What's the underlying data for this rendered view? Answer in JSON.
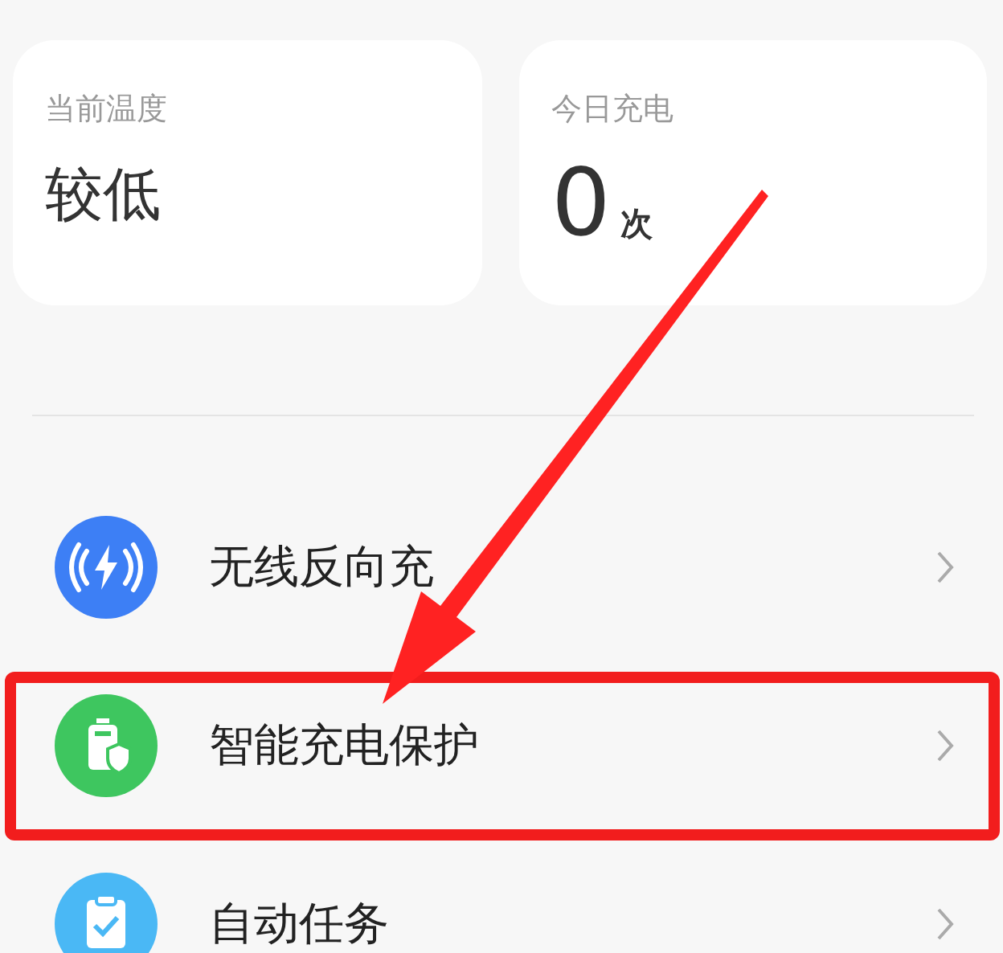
{
  "stats": [
    {
      "label": "当前温度",
      "value": "较低"
    },
    {
      "label": "今日充电",
      "value": "0",
      "unit": "次"
    }
  ],
  "settings": [
    {
      "kind": "wireless",
      "label": "无线反向充",
      "color": "#3d7ff5",
      "highlighted": false
    },
    {
      "kind": "battery",
      "label": "智能充电保护",
      "color": "#3ec65f",
      "highlighted": true
    },
    {
      "kind": "task",
      "label": "自动任务",
      "color": "#4ab8f5",
      "highlighted": false
    }
  ]
}
